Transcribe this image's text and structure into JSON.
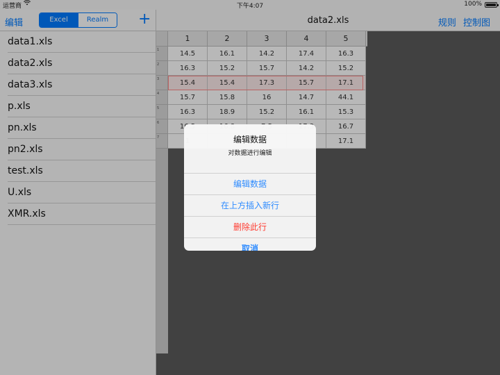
{
  "status_bar": {
    "carrier": "运营商",
    "wifi_icon": "wifi-icon",
    "time": "下午4:07",
    "battery": "100%"
  },
  "sidebar": {
    "edit_label": "编辑",
    "segments": [
      "Excel",
      "Realm"
    ],
    "selected_segment": "Excel",
    "add_icon": "plus-icon",
    "add_label": "+",
    "files": [
      "data1.xls",
      "data2.xls",
      "data3.xls",
      "p.xls",
      "pn.xls",
      "pn2.xls",
      "test.xls",
      "U.xls",
      "XMR.xls"
    ]
  },
  "main": {
    "title": "data2.xls",
    "nav_right": [
      "规则",
      "控制图"
    ],
    "columns": [
      "1",
      "2",
      "3",
      "4",
      "5"
    ],
    "rows": [
      [
        "14.5",
        "16.1",
        "14.2",
        "17.4",
        "16.3"
      ],
      [
        "16.3",
        "15.2",
        "15.7",
        "14.2",
        "15.2"
      ],
      [
        "15.4",
        "15.4",
        "17.3",
        "15.7",
        "17.1"
      ],
      [
        "15.7",
        "15.8",
        "16",
        "14.7",
        "44.1"
      ],
      [
        "16.3",
        "18.9",
        "15.2",
        "16.1",
        "15.3"
      ],
      [
        "16.5",
        "16.8",
        "7.5",
        "17.3",
        "16.7"
      ],
      [
        "1",
        "",
        "",
        "",
        "17.1"
      ]
    ],
    "row_labels": [
      "1",
      "2",
      "3",
      "4",
      "5",
      "6",
      "7"
    ],
    "selected_row": 2
  },
  "alert": {
    "title": "编辑数据",
    "message": "对数据进行编辑",
    "actions": [
      {
        "label": "编辑数据",
        "style": "default"
      },
      {
        "label": "在上方插入新行",
        "style": "default"
      },
      {
        "label": "删除此行",
        "style": "destructive"
      },
      {
        "label": "取消",
        "style": "cancel"
      }
    ]
  },
  "colors": {
    "accent": "#007aff",
    "destructive": "#ff3b30",
    "selection": "#ff8a8a"
  }
}
